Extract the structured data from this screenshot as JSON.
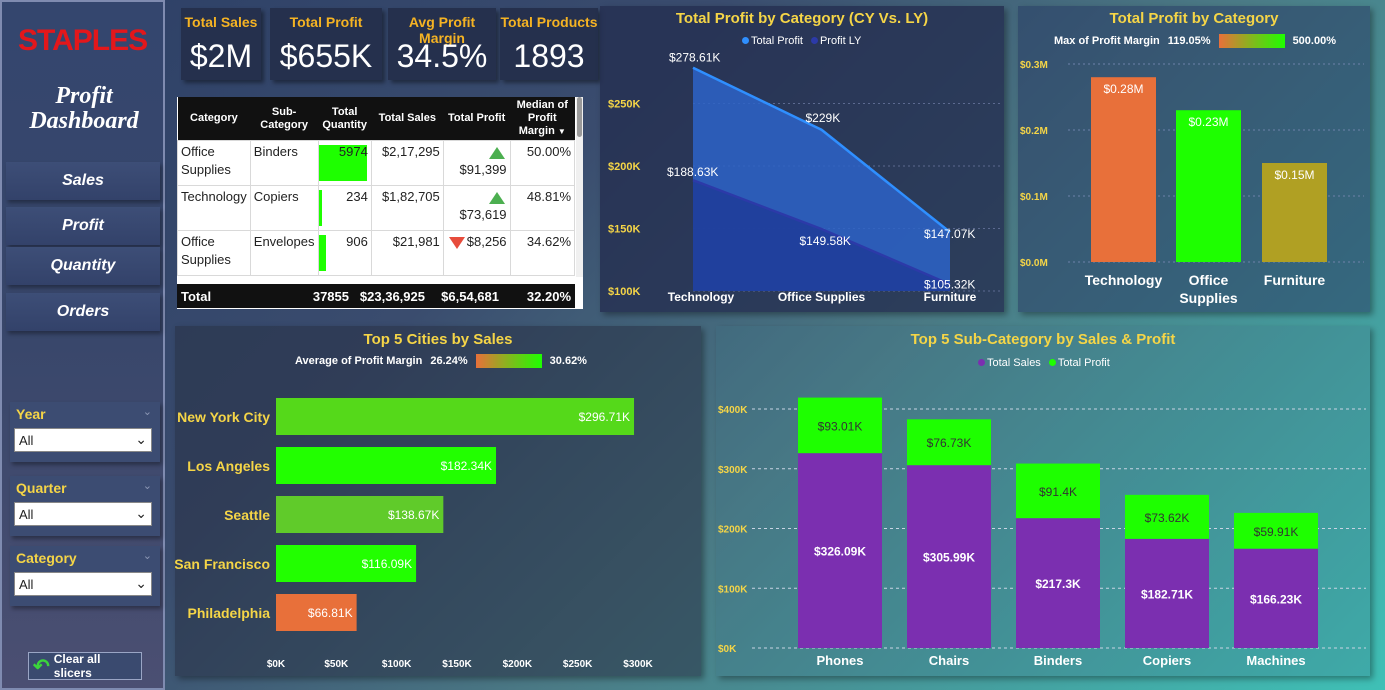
{
  "sidebar": {
    "logo": "STAPLES",
    "title": "Profit Dashboard",
    "nav": [
      "Sales",
      "Profit",
      "Quantity",
      "Orders"
    ],
    "slicers": [
      {
        "label": "Year",
        "value": "All"
      },
      {
        "label": "Quarter",
        "value": "All"
      },
      {
        "label": "Category",
        "value": "All"
      }
    ],
    "clear_label": "Clear all slicers"
  },
  "kpis": [
    {
      "title": "Total Sales",
      "value": "$2M"
    },
    {
      "title": "Total Profit",
      "value": "$655K"
    },
    {
      "title": "Avg Profit Margin",
      "value": "34.5%"
    },
    {
      "title": "Total Products",
      "value": "1893"
    }
  ],
  "table": {
    "headers": [
      "Category",
      "Sub-Category",
      "Total Quantity",
      "Total Sales",
      "Total Profit",
      "Median of Profit Margin"
    ],
    "rows": [
      {
        "category": "Office Supplies",
        "sub": "Binders",
        "qty": "5974",
        "qty_frac": 1.0,
        "sales": "$2,17,295",
        "profit": "$91,399",
        "trend": "up",
        "margin": "50.00%"
      },
      {
        "category": "Technology",
        "sub": "Copiers",
        "qty": "234",
        "qty_frac": 0.04,
        "sales": "$1,82,705",
        "profit": "$73,619",
        "trend": "up",
        "margin": "48.81%"
      },
      {
        "category": "Office Supplies",
        "sub": "Envelopes",
        "qty": "906",
        "qty_frac": 0.15,
        "sales": "$21,981",
        "profit": "$8,256",
        "trend": "down",
        "margin": "34.62%"
      }
    ],
    "total": {
      "label": "Total",
      "qty": "37855",
      "sales": "$23,36,925",
      "profit": "$6,54,681",
      "margin": "32.20%"
    }
  },
  "colors": {
    "accent_yellow": "#f5d547",
    "accent_orange": "#f5b323",
    "green": "#1eff00",
    "orange": "#e8703a",
    "purple": "#7b2fb0",
    "olive": "#b0a023"
  },
  "chart_data": [
    {
      "type": "area",
      "title": "Total Profit by Category (CY Vs. LY)",
      "categories": [
        "Technology",
        "Office Supplies",
        "Furniture"
      ],
      "series": [
        {
          "name": "Total Profit",
          "values": [
            278610,
            229000,
            147070
          ],
          "labels": [
            "$278.61K",
            "$229K",
            "$147.07K"
          ]
        },
        {
          "name": "Profit LY",
          "values": [
            188630,
            149580,
            105320
          ],
          "labels": [
            "$188.63K",
            "$149.58K",
            "$105.32K"
          ]
        }
      ],
      "ylim": [
        100000,
        280000
      ],
      "yticks": [
        "$100K",
        "$150K",
        "$200K",
        "$250K"
      ]
    },
    {
      "type": "bar",
      "title": "Total Profit by Category",
      "gradient_label": "Max of Profit Margin",
      "gradient_min": "119.05%",
      "gradient_max": "500.00%",
      "categories": [
        "Technology",
        "Office Supplies",
        "Furniture"
      ],
      "values": [
        0.28,
        0.23,
        0.15
      ],
      "labels": [
        "$0.28M",
        "$0.23M",
        "$0.15M"
      ],
      "ylim": [
        0,
        0.3
      ],
      "yticks": [
        "$0.0M",
        "$0.1M",
        "$0.2M",
        "$0.3M"
      ]
    },
    {
      "type": "bar",
      "orientation": "horizontal",
      "title": "Top 5 Cities by Sales",
      "gradient_label": "Average of Profit Margin",
      "gradient_min": "26.24%",
      "gradient_max": "30.62%",
      "categories": [
        "New York City",
        "Los Angeles",
        "Seattle",
        "San Francisco",
        "Philadelphia"
      ],
      "values": [
        296.71,
        182.34,
        138.67,
        116.09,
        66.81
      ],
      "labels": [
        "$296.71K",
        "$182.34K",
        "$138.67K",
        "$116.09K",
        "$66.81K"
      ],
      "xlim": [
        0,
        300
      ],
      "xticks": [
        "$0K",
        "$50K",
        "$100K",
        "$150K",
        "$200K",
        "$250K",
        "$300K"
      ]
    },
    {
      "type": "bar",
      "stacked": true,
      "title": "Top 5 Sub-Category by Sales & Profit",
      "categories": [
        "Phones",
        "Chairs",
        "Binders",
        "Copiers",
        "Machines"
      ],
      "series": [
        {
          "name": "Total Sales",
          "values": [
            326.09,
            305.99,
            217.3,
            182.71,
            166.23
          ],
          "labels": [
            "$326.09K",
            "$305.99K",
            "$217.3K",
            "$182.71K",
            "$166.23K"
          ]
        },
        {
          "name": "Total Profit",
          "values": [
            93.01,
            76.73,
            91.4,
            73.62,
            59.91
          ],
          "labels": [
            "$93.01K",
            "$76.73K",
            "$91.4K",
            "$73.62K",
            "$59.91K"
          ]
        }
      ],
      "ylim": [
        0,
        400
      ],
      "yticks": [
        "$0K",
        "$100K",
        "$200K",
        "$300K",
        "$400K"
      ]
    }
  ]
}
